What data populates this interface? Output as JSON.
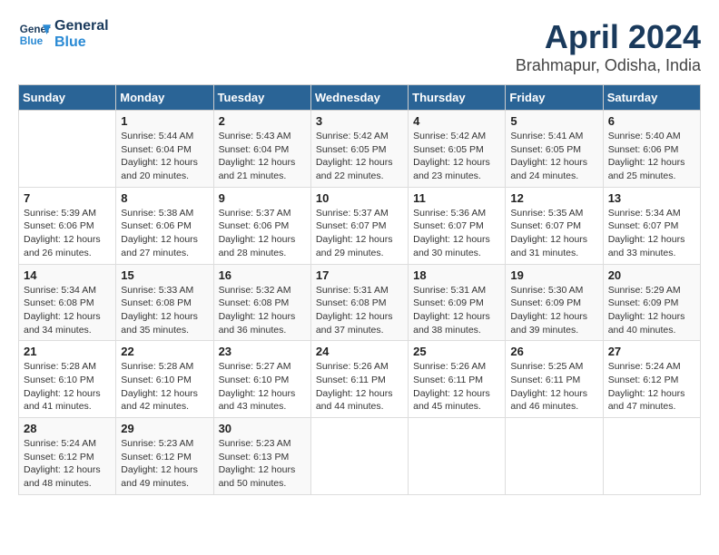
{
  "header": {
    "logo_line1": "General",
    "logo_line2": "Blue",
    "month": "April 2024",
    "location": "Brahmapur, Odisha, India"
  },
  "weekdays": [
    "Sunday",
    "Monday",
    "Tuesday",
    "Wednesday",
    "Thursday",
    "Friday",
    "Saturday"
  ],
  "weeks": [
    [
      {
        "day": "",
        "info": ""
      },
      {
        "day": "1",
        "info": "Sunrise: 5:44 AM\nSunset: 6:04 PM\nDaylight: 12 hours\nand 20 minutes."
      },
      {
        "day": "2",
        "info": "Sunrise: 5:43 AM\nSunset: 6:04 PM\nDaylight: 12 hours\nand 21 minutes."
      },
      {
        "day": "3",
        "info": "Sunrise: 5:42 AM\nSunset: 6:05 PM\nDaylight: 12 hours\nand 22 minutes."
      },
      {
        "day": "4",
        "info": "Sunrise: 5:42 AM\nSunset: 6:05 PM\nDaylight: 12 hours\nand 23 minutes."
      },
      {
        "day": "5",
        "info": "Sunrise: 5:41 AM\nSunset: 6:05 PM\nDaylight: 12 hours\nand 24 minutes."
      },
      {
        "day": "6",
        "info": "Sunrise: 5:40 AM\nSunset: 6:06 PM\nDaylight: 12 hours\nand 25 minutes."
      }
    ],
    [
      {
        "day": "7",
        "info": "Sunrise: 5:39 AM\nSunset: 6:06 PM\nDaylight: 12 hours\nand 26 minutes."
      },
      {
        "day": "8",
        "info": "Sunrise: 5:38 AM\nSunset: 6:06 PM\nDaylight: 12 hours\nand 27 minutes."
      },
      {
        "day": "9",
        "info": "Sunrise: 5:37 AM\nSunset: 6:06 PM\nDaylight: 12 hours\nand 28 minutes."
      },
      {
        "day": "10",
        "info": "Sunrise: 5:37 AM\nSunset: 6:07 PM\nDaylight: 12 hours\nand 29 minutes."
      },
      {
        "day": "11",
        "info": "Sunrise: 5:36 AM\nSunset: 6:07 PM\nDaylight: 12 hours\nand 30 minutes."
      },
      {
        "day": "12",
        "info": "Sunrise: 5:35 AM\nSunset: 6:07 PM\nDaylight: 12 hours\nand 31 minutes."
      },
      {
        "day": "13",
        "info": "Sunrise: 5:34 AM\nSunset: 6:07 PM\nDaylight: 12 hours\nand 33 minutes."
      }
    ],
    [
      {
        "day": "14",
        "info": "Sunrise: 5:34 AM\nSunset: 6:08 PM\nDaylight: 12 hours\nand 34 minutes."
      },
      {
        "day": "15",
        "info": "Sunrise: 5:33 AM\nSunset: 6:08 PM\nDaylight: 12 hours\nand 35 minutes."
      },
      {
        "day": "16",
        "info": "Sunrise: 5:32 AM\nSunset: 6:08 PM\nDaylight: 12 hours\nand 36 minutes."
      },
      {
        "day": "17",
        "info": "Sunrise: 5:31 AM\nSunset: 6:08 PM\nDaylight: 12 hours\nand 37 minutes."
      },
      {
        "day": "18",
        "info": "Sunrise: 5:31 AM\nSunset: 6:09 PM\nDaylight: 12 hours\nand 38 minutes."
      },
      {
        "day": "19",
        "info": "Sunrise: 5:30 AM\nSunset: 6:09 PM\nDaylight: 12 hours\nand 39 minutes."
      },
      {
        "day": "20",
        "info": "Sunrise: 5:29 AM\nSunset: 6:09 PM\nDaylight: 12 hours\nand 40 minutes."
      }
    ],
    [
      {
        "day": "21",
        "info": "Sunrise: 5:28 AM\nSunset: 6:10 PM\nDaylight: 12 hours\nand 41 minutes."
      },
      {
        "day": "22",
        "info": "Sunrise: 5:28 AM\nSunset: 6:10 PM\nDaylight: 12 hours\nand 42 minutes."
      },
      {
        "day": "23",
        "info": "Sunrise: 5:27 AM\nSunset: 6:10 PM\nDaylight: 12 hours\nand 43 minutes."
      },
      {
        "day": "24",
        "info": "Sunrise: 5:26 AM\nSunset: 6:11 PM\nDaylight: 12 hours\nand 44 minutes."
      },
      {
        "day": "25",
        "info": "Sunrise: 5:26 AM\nSunset: 6:11 PM\nDaylight: 12 hours\nand 45 minutes."
      },
      {
        "day": "26",
        "info": "Sunrise: 5:25 AM\nSunset: 6:11 PM\nDaylight: 12 hours\nand 46 minutes."
      },
      {
        "day": "27",
        "info": "Sunrise: 5:24 AM\nSunset: 6:12 PM\nDaylight: 12 hours\nand 47 minutes."
      }
    ],
    [
      {
        "day": "28",
        "info": "Sunrise: 5:24 AM\nSunset: 6:12 PM\nDaylight: 12 hours\nand 48 minutes."
      },
      {
        "day": "29",
        "info": "Sunrise: 5:23 AM\nSunset: 6:12 PM\nDaylight: 12 hours\nand 49 minutes."
      },
      {
        "day": "30",
        "info": "Sunrise: 5:23 AM\nSunset: 6:13 PM\nDaylight: 12 hours\nand 50 minutes."
      },
      {
        "day": "",
        "info": ""
      },
      {
        "day": "",
        "info": ""
      },
      {
        "day": "",
        "info": ""
      },
      {
        "day": "",
        "info": ""
      }
    ]
  ]
}
